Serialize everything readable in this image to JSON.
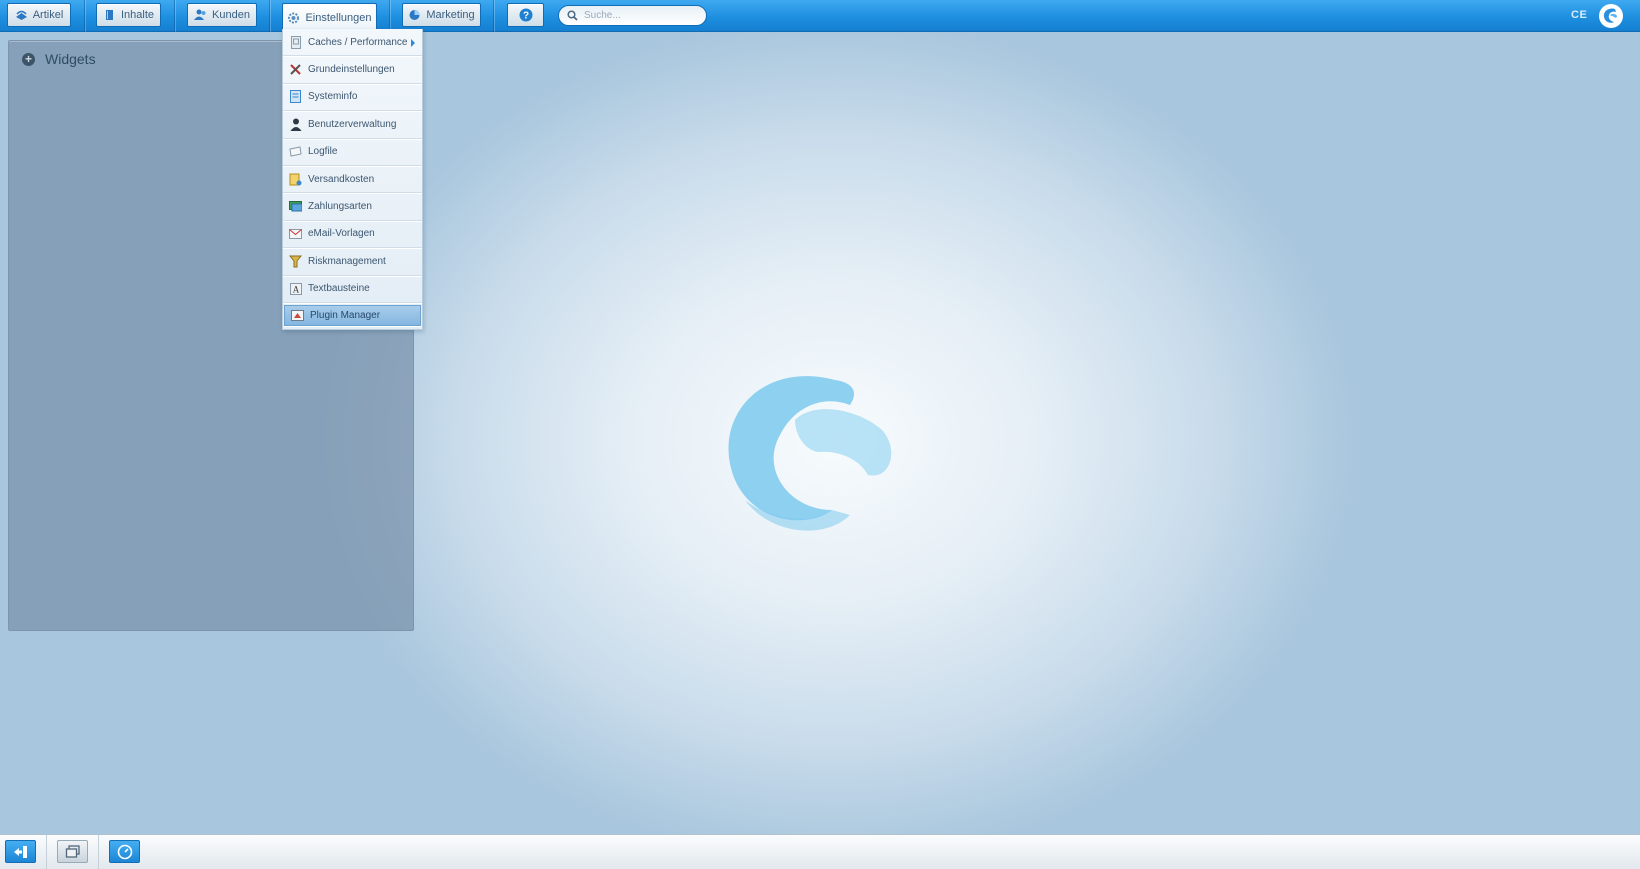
{
  "topbar": {
    "menu": [
      {
        "label": "Artikel",
        "icon": "stack-icon"
      },
      {
        "label": "Inhalte",
        "icon": "book-icon"
      },
      {
        "label": "Kunden",
        "icon": "users-icon"
      },
      {
        "label": "Einstellungen",
        "icon": "gear-icon"
      },
      {
        "label": "Marketing",
        "icon": "pie-chart-icon"
      }
    ],
    "help_icon": "help-icon",
    "search": {
      "placeholder": "Suche..."
    },
    "edition": "CE"
  },
  "dropdown": {
    "items": [
      {
        "label": "Caches / Performance",
        "icon": "cache-icon",
        "submenu": true
      },
      {
        "label": "Grundeinstellungen",
        "icon": "tools-icon"
      },
      {
        "label": "Systeminfo",
        "icon": "document-icon"
      },
      {
        "label": "Benutzerverwaltung",
        "icon": "user-icon"
      },
      {
        "label": "Logfile",
        "icon": "log-icon"
      },
      {
        "label": "Versandkosten",
        "icon": "shipping-icon"
      },
      {
        "label": "Zahlungsarten",
        "icon": "payment-icon"
      },
      {
        "label": "eMail-Vorlagen",
        "icon": "mail-icon"
      },
      {
        "label": "Riskmanagement",
        "icon": "risk-icon"
      },
      {
        "label": "Textbausteine",
        "icon": "text-icon"
      },
      {
        "label": "Plugin Manager",
        "icon": "plugin-icon",
        "selected": true
      }
    ]
  },
  "widgets": {
    "title": "Widgets"
  },
  "colors": {
    "topbar": "#1e8fe0",
    "accent": "#3fa9f0",
    "selected": "#84b6e0"
  }
}
